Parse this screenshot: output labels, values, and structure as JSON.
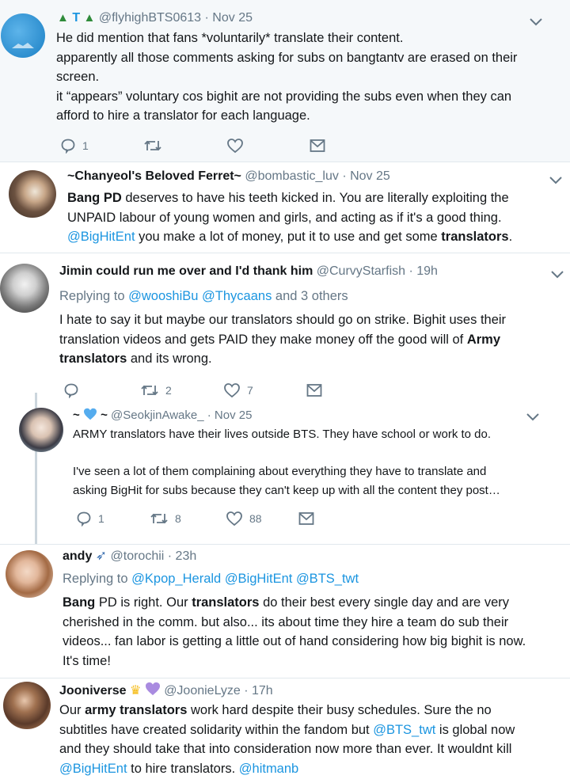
{
  "tweets": [
    {
      "name": "T",
      "handle": "@flyhighBTS0613",
      "time": "· Nov 25",
      "lines": [
        "He did mention that fans *voluntarily* translate their content.",
        "apparently all those comments asking for subs on bangtantv are erased on their",
        "screen.",
        "it “appears” voluntary cos bighit are not providing the subs even when they can",
        "afford to hire a translator for each language."
      ],
      "reply_count": "1",
      "retweet_count": "",
      "like_count": ""
    },
    {
      "name": "~Chanyeol's Beloved Ferret~",
      "handle": "@bombastic_luv",
      "time": "· Nov 25",
      "l1_bold": "Bang PD",
      "l1_rest": " deserves to have his teeth kicked in. You are literally exploiting the",
      "l2": "UNPAID labour of young women and girls, and acting as if it's a good thing.",
      "l3_link": "@BigHitEnt",
      "l3_rest": " you make a lot of money, put it to use and get some ",
      "l3_bold": "translators",
      "l3_end": "."
    },
    {
      "name": "Jimin could run me over and I'd thank him",
      "handle": "@CurvyStarfish",
      "time": "· 19h",
      "replying_prefix": "Replying to ",
      "reply_link1": "@wooshiBu",
      "reply_link2": "@Thycaans",
      "reply_suffix": " and 3 others",
      "l1": "I hate to say it but maybe our translators should go on strike. Bighit uses their",
      "l2_rest": "translation videos and gets PAID they make money off the good will of ",
      "l2_bold": "Army",
      "l3_bold": "translators",
      "l3_rest": " and its wrong.",
      "reply_count": "",
      "retweet_count": "2",
      "like_count": "7"
    },
    {
      "name_prefix": "~",
      "name_suffix": "~",
      "handle": "@SeokjinAwake_",
      "time": "· Nov 25",
      "lines": [
        "ARMY translators have their lives outside BTS. They have school or work to do.",
        "",
        "I've seen a lot of them complaining about everything they have to translate and",
        "asking BigHit for subs because they can't keep up with all the content they post…"
      ],
      "reply_count": "1",
      "retweet_count": "8",
      "like_count": "88"
    },
    {
      "name": "andy",
      "handle": "@torochii",
      "time": "· 23h",
      "replying_prefix": "Replying to ",
      "reply_link1": "@Kpop_Herald",
      "reply_link2": "@BigHitEnt",
      "reply_link3": "@BTS_twt",
      "l1_bold": "Bang",
      "l1_mid": " PD is right. Our ",
      "l1_bold2": "translators",
      "l1_rest": " do their best every single day and are very",
      "l2": "cherished in the comm. but also... its about time they hire a team do sub their",
      "l3": "videos... fan labor is getting a little out of hand considering how big bighit is now.",
      "l4": "It's time!"
    },
    {
      "name": "Jooniverse",
      "handle": "@JoonieLyze",
      "time": "· 17h",
      "l1_pre": "Our ",
      "l1_bold": "army translators",
      "l1_rest": " work hard despite their busy schedules. Sure the no",
      "l2_pre": "subtitles have created solidarity within the fandom but ",
      "l2_link": "@BTS_twt",
      "l2_rest": " is global now",
      "l3": "and they should take that into consideration now more than ever. It wouldnt kill",
      "l4_link": "@BigHitEnt",
      "l4_rest": " to hire translators. ",
      "l4_link2": "@hitmanb"
    }
  ],
  "icons": [
    "tree-icon",
    "heart-icon",
    "rocket-icon",
    "crown-icon",
    "reply-icon",
    "retweet-icon",
    "like-icon",
    "dm-icon",
    "chevron-down-icon"
  ],
  "colors": {
    "link": "#1b95e0",
    "meta": "#657786",
    "thread": "#ccd6dd",
    "heart_purple": "#a98be0",
    "heart_blue": "#55acee"
  }
}
